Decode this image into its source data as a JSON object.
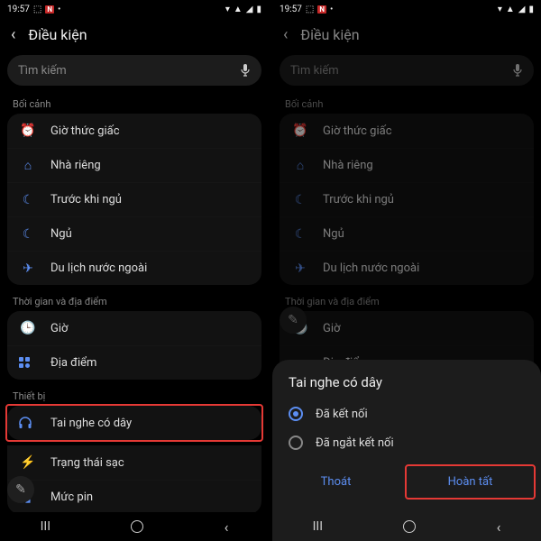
{
  "status": {
    "time": "19:57",
    "badge": "N"
  },
  "header": {
    "title": "Điều kiện"
  },
  "search": {
    "placeholder": "Tìm kiếm"
  },
  "sections": {
    "context": "Bối cảnh",
    "timeplace": "Thời gian và địa điểm",
    "device": "Thiết bị"
  },
  "items": {
    "wake": "Giờ thức giấc",
    "home": "Nhà riêng",
    "before_sleep": "Trước khi ngủ",
    "sleep": "Ngủ",
    "travel": "Du lịch nước ngoài",
    "time": "Giờ",
    "place": "Địa điểm",
    "headphone": "Tai nghe có dây",
    "charging": "Trạng thái sạc",
    "battery": "Mức pin"
  },
  "dialog": {
    "title": "Tai nghe có dây",
    "connected": "Đã kết nối",
    "disconnected": "Đã ngắt kết nối",
    "cancel": "Thoát",
    "done": "Hoàn tất"
  }
}
